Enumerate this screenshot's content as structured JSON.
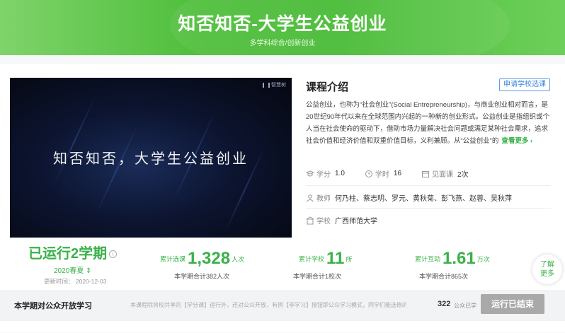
{
  "header": {
    "title": "知否知否-大学生公益创业",
    "subtitle": "多学科综合/创新创业"
  },
  "video": {
    "overlay_text": "知否知否，大学生公益创业",
    "watermark": "智慧树"
  },
  "intro": {
    "title": "课程介绍",
    "apply_button": "申请学校选课",
    "description": "公益创业，也称为“社会创业”(Social Entrepreneurship)，与商业创业相对而言，是20世纪90年代以来在全球范围内兴起的一种新的创业形式。公益创业是指组织或个人当在社会使命的驱动下，借助市场力量解决社会问题或满足某种社会需求，追求社会价值和经济价值和双重价值目标，义利兼顾。从“公益创业”的",
    "more_link": "查看更多 ›"
  },
  "meta": {
    "credit_label": "学分",
    "credit_value": "1.0",
    "hours_label": "学时",
    "hours_value": "16",
    "meet_label": "见面课",
    "meet_value": "2次",
    "teacher_label": "教师",
    "teacher_value": "何乃柱、蔡志明、罗元、黄秋菊、彭飞燕、赵蓉、吴秋萍",
    "school_label": "学校",
    "school_value": "广西师范大学"
  },
  "run": {
    "main": "已运行2学期",
    "info_icon": "i",
    "term": "2020春夏 ⇕",
    "updated": "更新时间： 2020-12-03"
  },
  "stats": [
    {
      "label": "累计选课",
      "value": "1,328",
      "unit": "人次",
      "sub": "本学期合计382人次"
    },
    {
      "label": "累计学校",
      "value": "11",
      "unit": "所",
      "sub": "本学期合计1校次"
    },
    {
      "label": "累计互动",
      "value": "1.61",
      "unit": "万次",
      "sub": "本学期合计865次"
    }
  ],
  "learn_more": {
    "line1": "了解",
    "line2": "更多"
  },
  "open": {
    "label": "本学期对公众开放学习",
    "note": "本课程除将校共享的【学分课】运行外，还对公众开放，有例【非学习】按钮即公众学习模式，同学们能选修的…",
    "count": "322",
    "count_label": "公众已学",
    "end_button": "运行已结束"
  },
  "colors": {
    "brand_green": "#3bb14a",
    "header_green": "#4fbf3c",
    "link_blue": "#3d86d8",
    "ended_gray": "#a9a9a9"
  }
}
